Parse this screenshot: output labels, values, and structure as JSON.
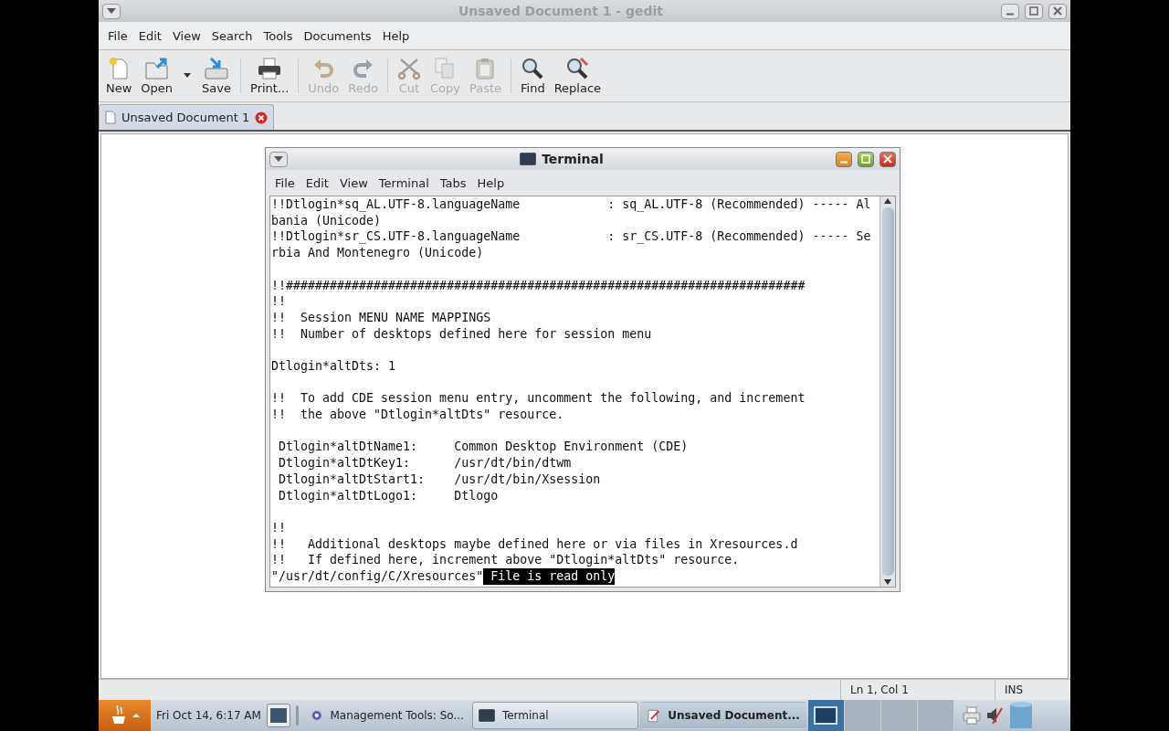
{
  "gedit": {
    "title": "Unsaved Document 1 - gedit",
    "menu": [
      "File",
      "Edit",
      "View",
      "Search",
      "Tools",
      "Documents",
      "Help"
    ],
    "toolbar": [
      {
        "kind": "new",
        "label": "New",
        "disabled": false
      },
      {
        "kind": "open",
        "label": "Open",
        "disabled": false
      },
      {
        "kind": "dropdown",
        "disabled": false
      },
      {
        "kind": "save",
        "label": "Save",
        "disabled": false
      },
      {
        "kind": "sep"
      },
      {
        "kind": "print",
        "label": "Print...",
        "disabled": false
      },
      {
        "kind": "sep"
      },
      {
        "kind": "undo",
        "label": "Undo",
        "disabled": true
      },
      {
        "kind": "redo",
        "label": "Redo",
        "disabled": true
      },
      {
        "kind": "sep"
      },
      {
        "kind": "cut",
        "label": "Cut",
        "disabled": true
      },
      {
        "kind": "copy",
        "label": "Copy",
        "disabled": true
      },
      {
        "kind": "paste",
        "label": "Paste",
        "disabled": true
      },
      {
        "kind": "sep"
      },
      {
        "kind": "find",
        "label": "Find",
        "disabled": false
      },
      {
        "kind": "replace",
        "label": "Replace",
        "disabled": false
      }
    ],
    "tabs": [
      {
        "label": "Unsaved Document 1",
        "selected": true
      }
    ],
    "status_bar": {
      "position": "Ln 1, Col 1",
      "mode": "INS"
    }
  },
  "terminal": {
    "title": "Terminal",
    "menu": [
      "File",
      "Edit",
      "View",
      "Terminal",
      "Tabs",
      "Help"
    ],
    "blocks": [
      [
        "!!Dtlogin*sq_AL.UTF-8.languageName            : sq_AL.UTF-8 (Recommended) ----- Al",
        "bania (Unicode)",
        "!!Dtlogin*sr_CS.UTF-8.languageName            : sr_CS.UTF-8 (Recommended) ----- Se",
        "rbia And Montenegro (Unicode)"
      ],
      [
        "!!#######################################################################",
        "!!",
        "!!  Session MENU NAME MAPPINGS",
        "!!  Number of desktops defined here for session menu"
      ],
      [
        "Dtlogin*altDts: 1"
      ],
      [
        "!!  To add CDE session menu entry, uncomment the following, and increment",
        "!!  the above \"Dtlogin*altDts\" resource."
      ],
      [
        " Dtlogin*altDtName1:     Common Desktop Environment (CDE)",
        " Dtlogin*altDtKey1:      /usr/dt/bin/dtwm",
        " Dtlogin*altDtStart1:    /usr/dt/bin/Xsession",
        " Dtlogin*altDtLogo1:     Dtlogo"
      ],
      [
        "!!",
        "!!   Additional desktops maybe defined here or via files in Xresources.d",
        "!!   If defined here, increment above \"Dtlogin*altDts\" resource."
      ]
    ],
    "status_line": {
      "path": "\"/usr/dt/config/C/Xresources\"",
      "message": " File is read only"
    }
  },
  "taskbar": {
    "clock": "Fri Oct 14,  6:17 AM",
    "tasks": [
      {
        "kind": "gear",
        "label": "Management Tools: So...",
        "selected": false
      },
      {
        "kind": "terminal",
        "label": "Terminal",
        "selected": false
      },
      {
        "kind": "editor",
        "label": "Unsaved Document...",
        "selected": true
      }
    ],
    "workspaces": [
      {
        "selected": true
      },
      {
        "selected": false
      },
      {
        "selected": false
      },
      {
        "selected": false
      }
    ]
  }
}
